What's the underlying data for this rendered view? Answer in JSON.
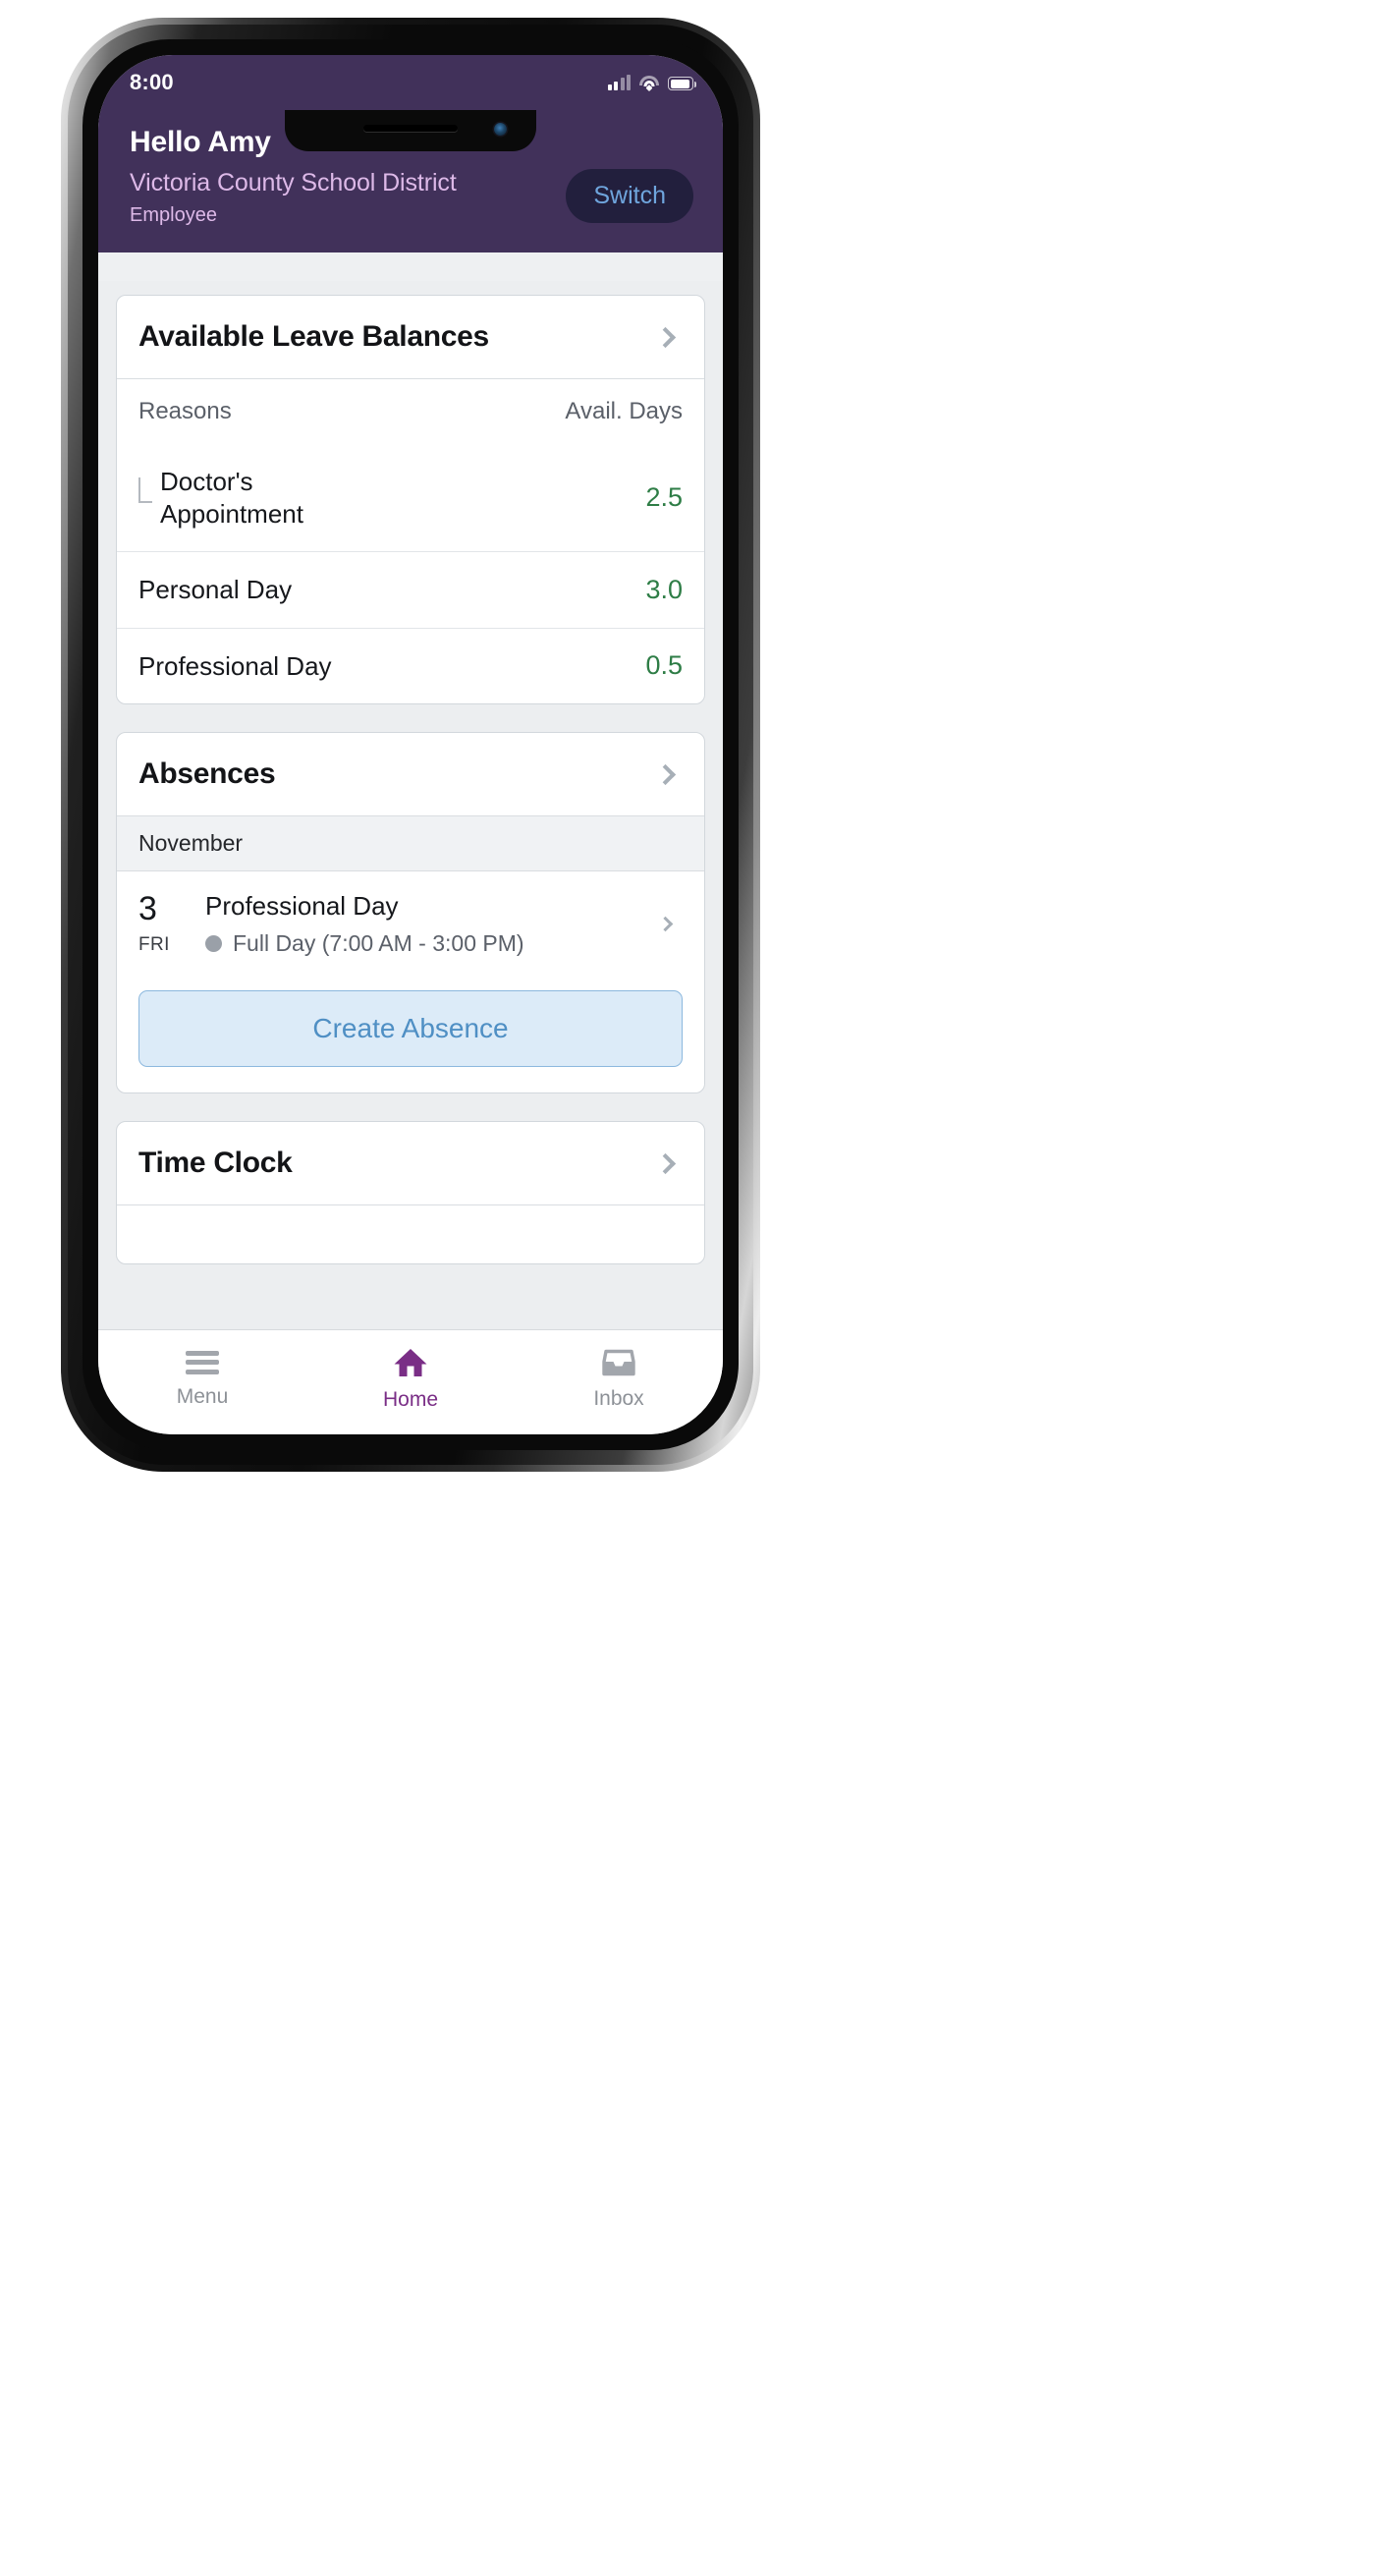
{
  "status_bar": {
    "time": "8:00",
    "icons": [
      "signal-bars-icon",
      "wifi-icon",
      "battery-icon"
    ]
  },
  "header": {
    "greeting": "Hello Amy",
    "organization": "Victoria County School District",
    "role": "Employee",
    "switch_label": "Switch",
    "background_color": "#41315a",
    "switch_bg_color": "#221f3d",
    "switch_text_color": "#6fa5dd"
  },
  "leave_balances": {
    "title": "Available Leave Balances",
    "columns": [
      "Reasons",
      "Avail. Days"
    ],
    "value_color": "#2e7d46",
    "rows": [
      {
        "name_line1": "Doctor's",
        "name_line2": "Appointment",
        "value": "2.5",
        "nested": true
      },
      {
        "name_line1": "Personal Day",
        "name_line2": "",
        "value": "3.0",
        "nested": false
      },
      {
        "name_line1": "Professional Day",
        "name_line2": "",
        "value": "0.5",
        "nested": false
      }
    ]
  },
  "absences": {
    "title": "Absences",
    "month": "November",
    "entries": [
      {
        "day": "3",
        "weekday": "FRI",
        "title": "Professional Day",
        "detail": "Full Day (7:00 AM - 3:00 PM)",
        "status_dot_color": "#9aa0a8"
      }
    ],
    "create_label": "Create Absence",
    "create_bg_color": "#dcebf8",
    "create_text_color": "#4f8fc4"
  },
  "time_clock": {
    "title": "Time Clock"
  },
  "tab_bar": {
    "active_color": "#7a2e86",
    "inactive_color": "#8d9197",
    "tabs": [
      {
        "label": "Menu",
        "icon": "hamburger-menu-icon",
        "active": false
      },
      {
        "label": "Home",
        "icon": "home-icon",
        "active": true
      },
      {
        "label": "Inbox",
        "icon": "inbox-tray-icon",
        "active": false
      }
    ]
  }
}
